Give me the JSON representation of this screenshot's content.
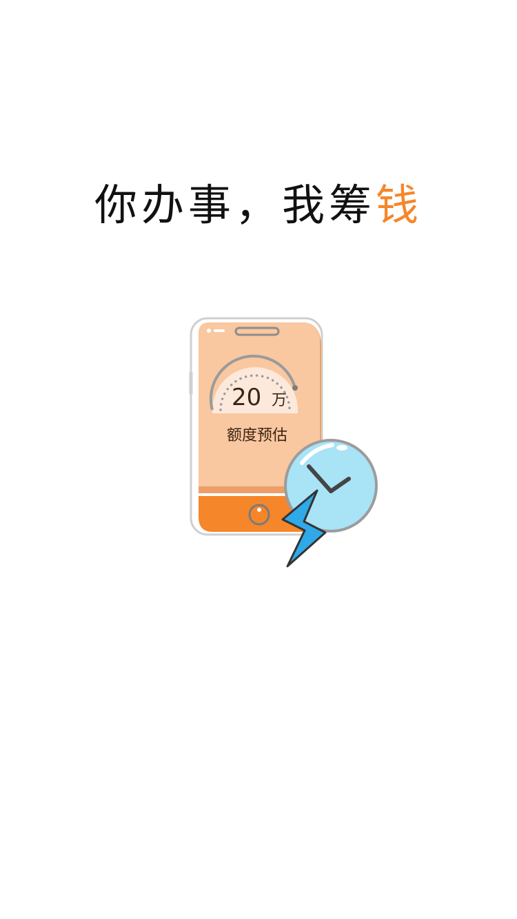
{
  "slogan": {
    "part1": "你办事，我筹",
    "part2": "钱"
  },
  "illustration": {
    "amount_value": "20",
    "amount_unit": "万",
    "caption": "额度预估"
  },
  "colors": {
    "accent": "#f5862a",
    "screen": "#f9c7a0",
    "phone_side": "#f0a060",
    "clock_face": "#a8e3f6",
    "bolt": "#2fa9e8"
  }
}
